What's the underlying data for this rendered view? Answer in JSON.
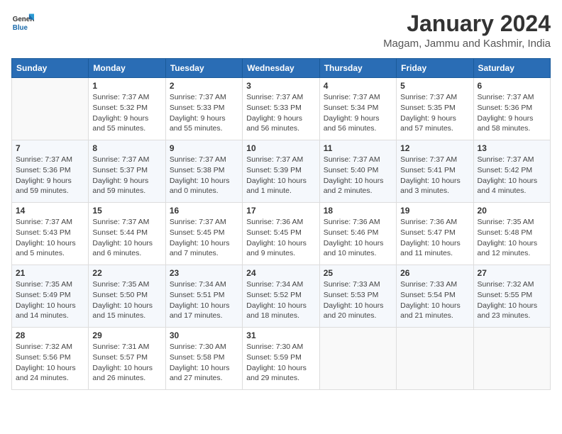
{
  "header": {
    "logo_general": "General",
    "logo_blue": "Blue",
    "title": "January 2024",
    "subtitle": "Magam, Jammu and Kashmir, India"
  },
  "weekdays": [
    "Sunday",
    "Monday",
    "Tuesday",
    "Wednesday",
    "Thursday",
    "Friday",
    "Saturday"
  ],
  "weeks": [
    [
      {
        "day": "",
        "info": ""
      },
      {
        "day": "1",
        "info": "Sunrise: 7:37 AM\nSunset: 5:32 PM\nDaylight: 9 hours\nand 55 minutes."
      },
      {
        "day": "2",
        "info": "Sunrise: 7:37 AM\nSunset: 5:33 PM\nDaylight: 9 hours\nand 55 minutes."
      },
      {
        "day": "3",
        "info": "Sunrise: 7:37 AM\nSunset: 5:33 PM\nDaylight: 9 hours\nand 56 minutes."
      },
      {
        "day": "4",
        "info": "Sunrise: 7:37 AM\nSunset: 5:34 PM\nDaylight: 9 hours\nand 56 minutes."
      },
      {
        "day": "5",
        "info": "Sunrise: 7:37 AM\nSunset: 5:35 PM\nDaylight: 9 hours\nand 57 minutes."
      },
      {
        "day": "6",
        "info": "Sunrise: 7:37 AM\nSunset: 5:36 PM\nDaylight: 9 hours\nand 58 minutes."
      }
    ],
    [
      {
        "day": "7",
        "info": "Sunrise: 7:37 AM\nSunset: 5:36 PM\nDaylight: 9 hours\nand 59 minutes."
      },
      {
        "day": "8",
        "info": "Sunrise: 7:37 AM\nSunset: 5:37 PM\nDaylight: 9 hours\nand 59 minutes."
      },
      {
        "day": "9",
        "info": "Sunrise: 7:37 AM\nSunset: 5:38 PM\nDaylight: 10 hours\nand 0 minutes."
      },
      {
        "day": "10",
        "info": "Sunrise: 7:37 AM\nSunset: 5:39 PM\nDaylight: 10 hours\nand 1 minute."
      },
      {
        "day": "11",
        "info": "Sunrise: 7:37 AM\nSunset: 5:40 PM\nDaylight: 10 hours\nand 2 minutes."
      },
      {
        "day": "12",
        "info": "Sunrise: 7:37 AM\nSunset: 5:41 PM\nDaylight: 10 hours\nand 3 minutes."
      },
      {
        "day": "13",
        "info": "Sunrise: 7:37 AM\nSunset: 5:42 PM\nDaylight: 10 hours\nand 4 minutes."
      }
    ],
    [
      {
        "day": "14",
        "info": "Sunrise: 7:37 AM\nSunset: 5:43 PM\nDaylight: 10 hours\nand 5 minutes."
      },
      {
        "day": "15",
        "info": "Sunrise: 7:37 AM\nSunset: 5:44 PM\nDaylight: 10 hours\nand 6 minutes."
      },
      {
        "day": "16",
        "info": "Sunrise: 7:37 AM\nSunset: 5:45 PM\nDaylight: 10 hours\nand 7 minutes."
      },
      {
        "day": "17",
        "info": "Sunrise: 7:36 AM\nSunset: 5:45 PM\nDaylight: 10 hours\nand 9 minutes."
      },
      {
        "day": "18",
        "info": "Sunrise: 7:36 AM\nSunset: 5:46 PM\nDaylight: 10 hours\nand 10 minutes."
      },
      {
        "day": "19",
        "info": "Sunrise: 7:36 AM\nSunset: 5:47 PM\nDaylight: 10 hours\nand 11 minutes."
      },
      {
        "day": "20",
        "info": "Sunrise: 7:35 AM\nSunset: 5:48 PM\nDaylight: 10 hours\nand 12 minutes."
      }
    ],
    [
      {
        "day": "21",
        "info": "Sunrise: 7:35 AM\nSunset: 5:49 PM\nDaylight: 10 hours\nand 14 minutes."
      },
      {
        "day": "22",
        "info": "Sunrise: 7:35 AM\nSunset: 5:50 PM\nDaylight: 10 hours\nand 15 minutes."
      },
      {
        "day": "23",
        "info": "Sunrise: 7:34 AM\nSunset: 5:51 PM\nDaylight: 10 hours\nand 17 minutes."
      },
      {
        "day": "24",
        "info": "Sunrise: 7:34 AM\nSunset: 5:52 PM\nDaylight: 10 hours\nand 18 minutes."
      },
      {
        "day": "25",
        "info": "Sunrise: 7:33 AM\nSunset: 5:53 PM\nDaylight: 10 hours\nand 20 minutes."
      },
      {
        "day": "26",
        "info": "Sunrise: 7:33 AM\nSunset: 5:54 PM\nDaylight: 10 hours\nand 21 minutes."
      },
      {
        "day": "27",
        "info": "Sunrise: 7:32 AM\nSunset: 5:55 PM\nDaylight: 10 hours\nand 23 minutes."
      }
    ],
    [
      {
        "day": "28",
        "info": "Sunrise: 7:32 AM\nSunset: 5:56 PM\nDaylight: 10 hours\nand 24 minutes."
      },
      {
        "day": "29",
        "info": "Sunrise: 7:31 AM\nSunset: 5:57 PM\nDaylight: 10 hours\nand 26 minutes."
      },
      {
        "day": "30",
        "info": "Sunrise: 7:30 AM\nSunset: 5:58 PM\nDaylight: 10 hours\nand 27 minutes."
      },
      {
        "day": "31",
        "info": "Sunrise: 7:30 AM\nSunset: 5:59 PM\nDaylight: 10 hours\nand 29 minutes."
      },
      {
        "day": "",
        "info": ""
      },
      {
        "day": "",
        "info": ""
      },
      {
        "day": "",
        "info": ""
      }
    ]
  ]
}
